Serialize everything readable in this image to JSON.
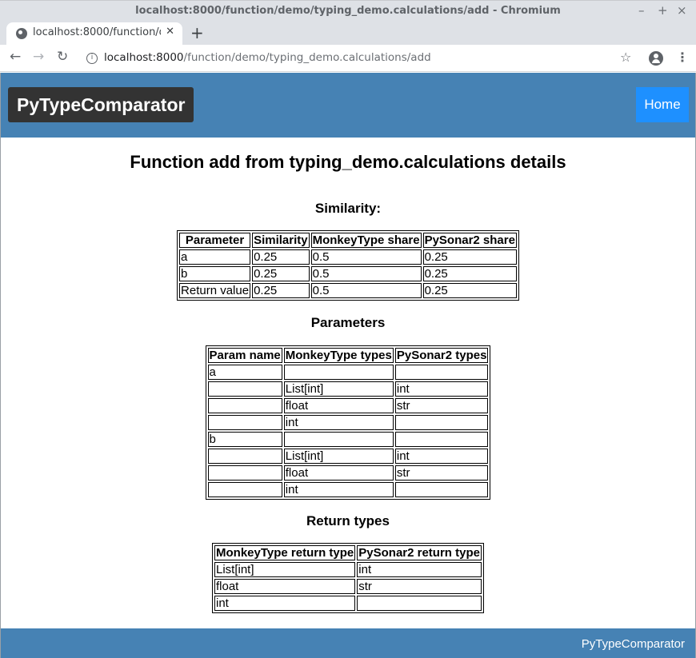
{
  "browser": {
    "window_title": "localhost:8000/function/demo/typing_demo.calculations/add - Chromium",
    "tab_title": "localhost:8000/function/d",
    "url_host": "localhost:8000",
    "url_path": "/function/demo/typing_demo.calculations/add"
  },
  "header": {
    "brand": "PyTypeComparator",
    "home_label": "Home"
  },
  "page_title": "Function add from typing_demo.calculations details",
  "similarity": {
    "heading": "Similarity:",
    "columns": [
      "Parameter",
      "Similarity",
      "MonkeyType share",
      "PySonar2 share"
    ],
    "rows": [
      [
        "a",
        "0.25",
        "0.5",
        "0.25"
      ],
      [
        "b",
        "0.25",
        "0.5",
        "0.25"
      ],
      [
        "Return value",
        "0.25",
        "0.5",
        "0.25"
      ]
    ]
  },
  "parameters": {
    "heading": "Parameters",
    "columns": [
      "Param name",
      "MonkeyType types",
      "PySonar2 types"
    ],
    "rows": [
      [
        "a",
        "",
        ""
      ],
      [
        "",
        "List[int]",
        "int"
      ],
      [
        "",
        "float",
        "str"
      ],
      [
        "",
        "int",
        ""
      ],
      [
        "b",
        "",
        ""
      ],
      [
        "",
        "List[int]",
        "int"
      ],
      [
        "",
        "float",
        "str"
      ],
      [
        "",
        "int",
        ""
      ]
    ]
  },
  "return_types": {
    "heading": "Return types",
    "columns": [
      "MonkeyType return type",
      "PySonar2 return type"
    ],
    "rows": [
      [
        "List[int]",
        "int"
      ],
      [
        "float",
        "str"
      ],
      [
        "int",
        ""
      ]
    ]
  },
  "footer": {
    "text": "PyTypeComparator"
  },
  "colors": {
    "header_bg": "#4682b4",
    "brand_bg": "#333333",
    "home_bg": "#1e90ff"
  }
}
